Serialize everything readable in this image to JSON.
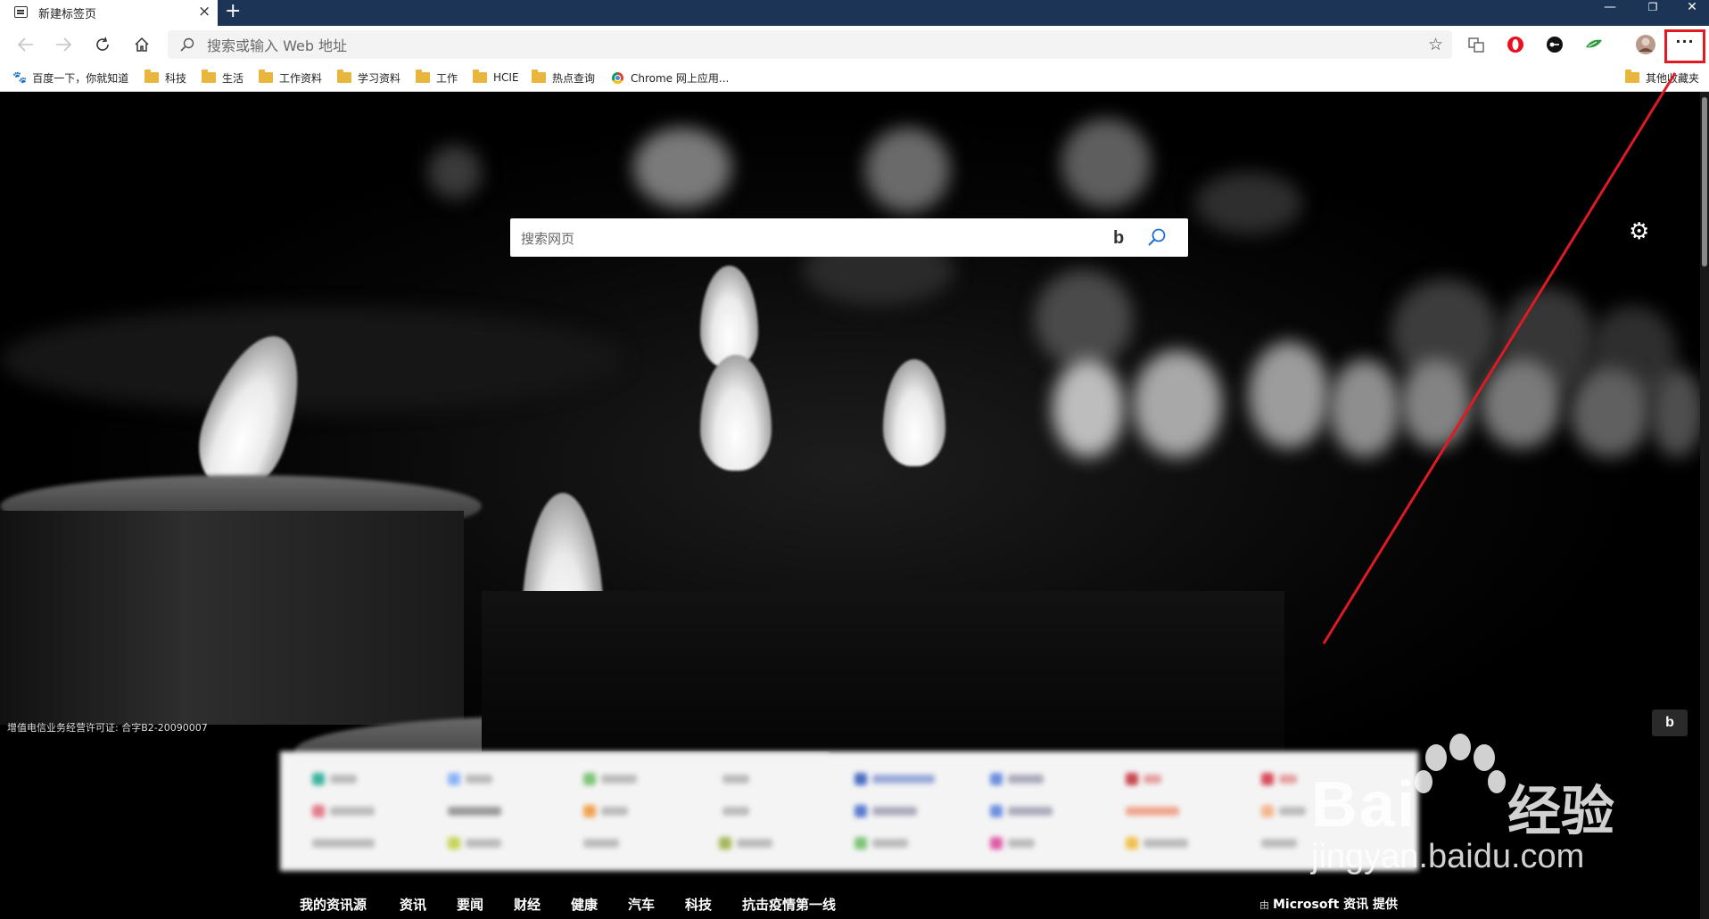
{
  "browser": {
    "tab_title": "新建标签页",
    "address_placeholder": "搜索或输入 Web 地址",
    "window_controls": {
      "minimize": "—",
      "restore": "❐",
      "close": "✕"
    }
  },
  "bookmarks": [
    {
      "label": "百度一下，你就知道",
      "type": "baidu"
    },
    {
      "label": "科技",
      "type": "folder"
    },
    {
      "label": "生活",
      "type": "folder"
    },
    {
      "label": "工作资料",
      "type": "folder"
    },
    {
      "label": "学习资料",
      "type": "folder"
    },
    {
      "label": "工作",
      "type": "folder"
    },
    {
      "label": "HCIE",
      "type": "folder"
    },
    {
      "label": "热点查询",
      "type": "folder"
    },
    {
      "label": "Chrome 网上应用...",
      "type": "chrome"
    },
    {
      "label": "其他收藏夹",
      "type": "folder"
    }
  ],
  "newtab": {
    "search_placeholder": "搜索网页",
    "license_text": "增值电信业务经营许可证: 合字B2-20090007",
    "news_tabs": [
      "我的资讯源",
      "资讯",
      "要闻",
      "财经",
      "健康",
      "汽车",
      "科技",
      "抗击疫情第一线"
    ],
    "provider_prefix": "由",
    "provider_label": "Microsoft 资讯 提供"
  },
  "watermark": {
    "brand": "Bai",
    "brand_suffix": "经验",
    "url": "jingyan.baidu.com"
  },
  "colors": {
    "titlebar": "#1c3557",
    "annotation": "#e01a24"
  }
}
